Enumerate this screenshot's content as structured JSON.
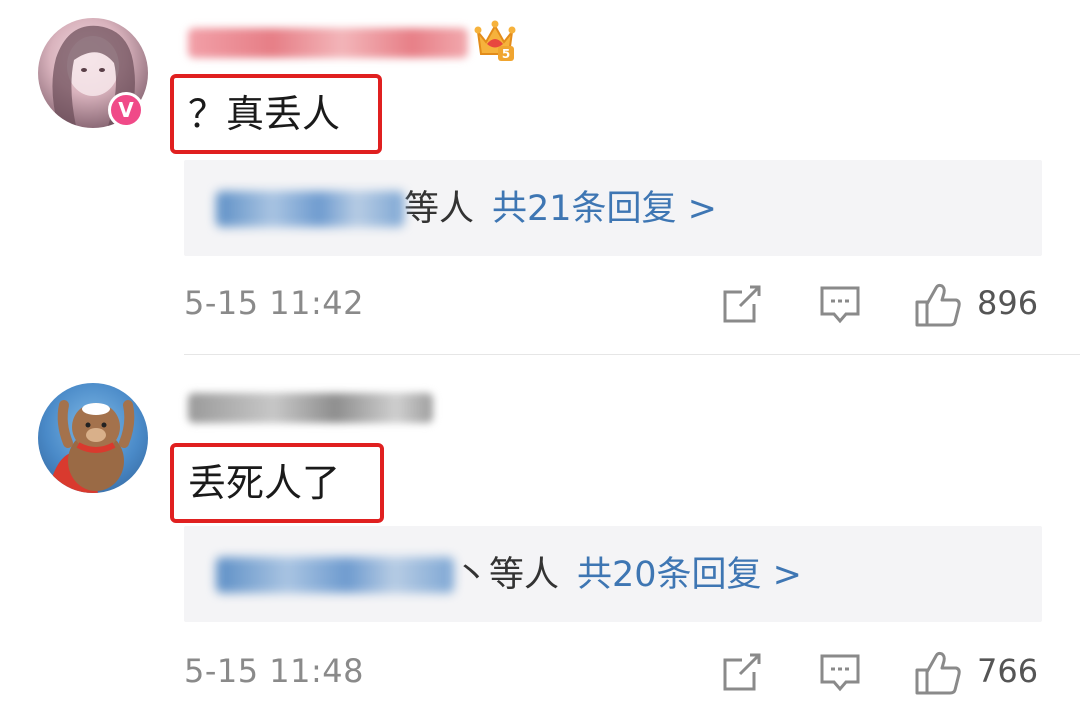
{
  "comments": [
    {
      "text": "？真丢人",
      "reply_suffix": "等人",
      "reply_count": "共21条回复 >",
      "timestamp": "5-15 11:42",
      "likes": "896",
      "vip_badge": "V",
      "crown_level": "5",
      "icons": {
        "share": "share-icon",
        "comment": "comment-icon",
        "like": "thumbs-up-icon"
      }
    },
    {
      "text": "丢死人了",
      "reply_suffix": "丶等人",
      "reply_count": "共20条回复 >",
      "timestamp": "5-15 11:48",
      "likes": "766",
      "icons": {
        "share": "share-icon",
        "comment": "comment-icon",
        "like": "thumbs-up-icon"
      }
    }
  ],
  "colors": {
    "highlight_border": "#e02020",
    "link_blue": "#3e76b3",
    "reply_box_bg": "#f4f4f6",
    "meta_gray": "#8a8a8a",
    "vip_pink": "#f04a88"
  }
}
